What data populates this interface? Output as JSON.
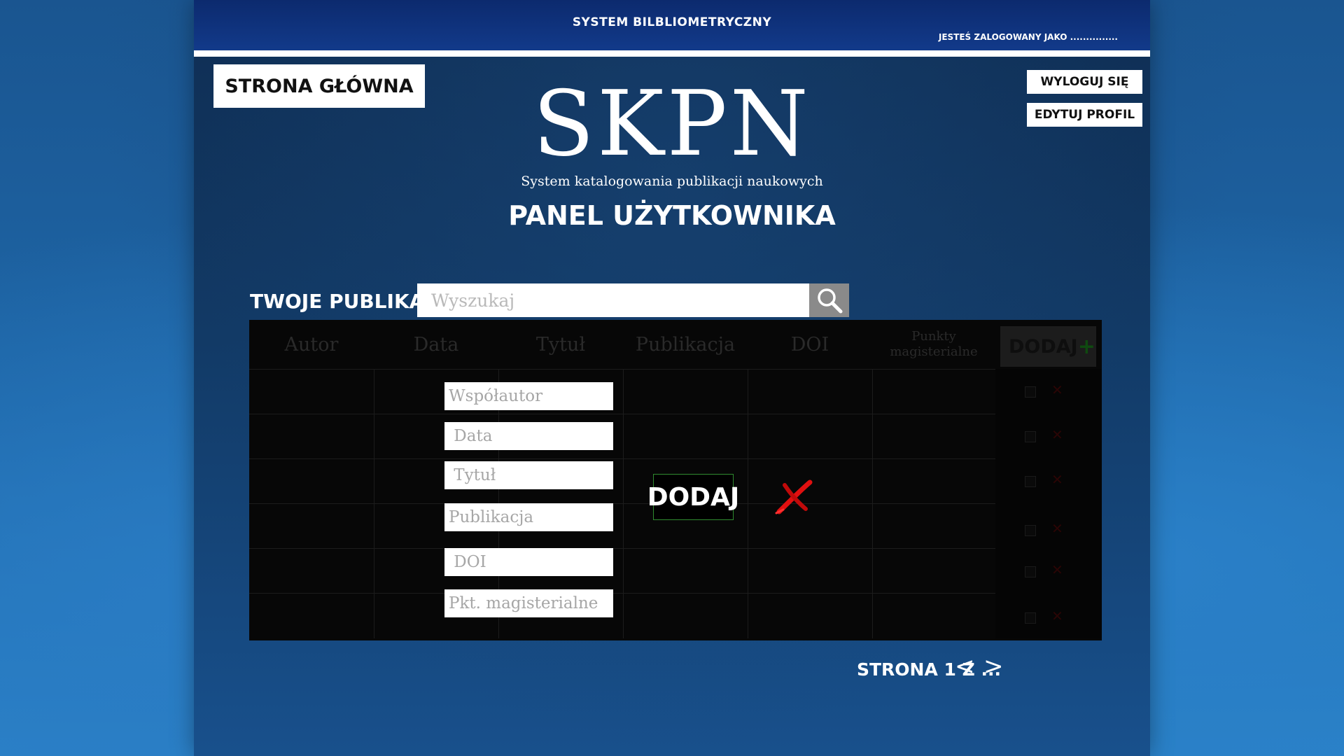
{
  "header": {
    "app_title": "SYSTEM BILBLIOMETRYCZNY",
    "login_status": "JESTEŚ ZALOGOWANY JAKO ..............."
  },
  "nav": {
    "home_label": "STRONA GŁÓWNA",
    "logout_label": "WYLOGUJ SIĘ",
    "edit_profile_label": "EDYTUJ PROFIL"
  },
  "branding": {
    "logo": "SKPN",
    "subtitle": "System katalogowania publikacji naukowych",
    "panel_title": "PANEL UŻYTKOWNIKA"
  },
  "publications": {
    "section_label": "TWOJE PUBLIKACJE",
    "search_placeholder": "Wyszukaj",
    "columns": [
      "Autor",
      "Data",
      "Tytuł",
      "Publikacja",
      "DOI",
      "Punkty magisterialne"
    ],
    "header_add_label": "DODAJ",
    "header_add_icon": "plus-icon",
    "row_count": 6
  },
  "add_form": {
    "coauthor_placeholder": "Współautor",
    "date_placeholder": " Data",
    "title_placeholder": " Tytuł",
    "publication_placeholder": "Publikacja",
    "doi_placeholder": " DOI",
    "points_placeholder": "Pkt. magisterialne",
    "submit_label": "DODAJ",
    "cancel_icon": "close-x-icon"
  },
  "pagination": {
    "label": "STRONA 1 Z ...",
    "prev": "<",
    "next": ">"
  },
  "colors": {
    "topbar": "#123a8a",
    "submit_border": "#2f8a2f",
    "cancel_red": "#e01010"
  }
}
